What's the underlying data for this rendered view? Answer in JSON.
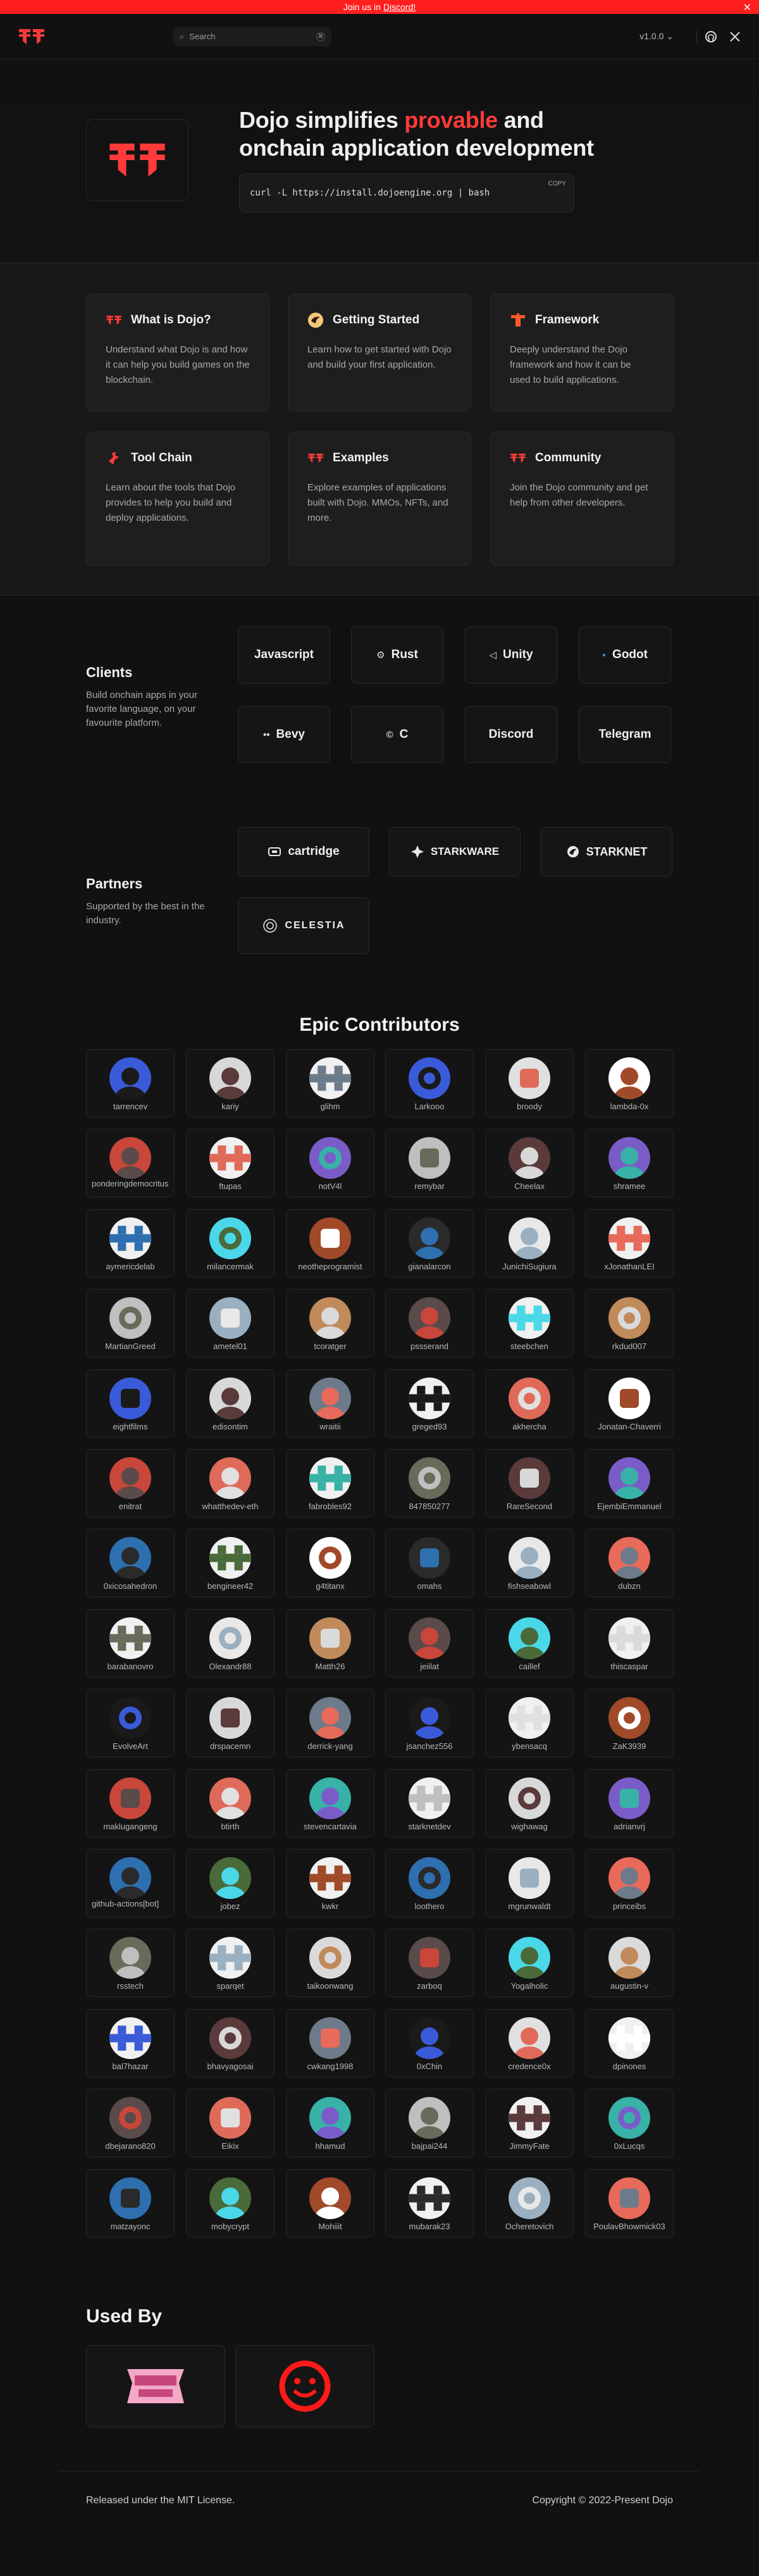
{
  "banner": {
    "text": "Join us in",
    "link": "Discord!",
    "close": "✕"
  },
  "nav": {
    "search_placeholder": "Search",
    "search_shortcut": "⌘",
    "version": "v1.0.0 ⌄",
    "github_icon": "github-icon",
    "x_icon": "x-icon"
  },
  "hero": {
    "title_pre": "Dojo simplifies ",
    "title_highlight": "provable",
    "title_post": " and",
    "title_line2": "onchain application development",
    "command": "curl -L https://install.dojoengine.org | bash",
    "copy_label": "COPY",
    "highlight_color": "#ff3a3a"
  },
  "features": [
    {
      "title": "What is Dojo?",
      "desc": "Understand what Dojo is and how it can help you build games on the blockchain.",
      "icon": "dojo-logo-icon"
    },
    {
      "title": "Getting Started",
      "desc": "Learn how to get started with Dojo and build your first application.",
      "icon": "starknet-bird-icon"
    },
    {
      "title": "Framework",
      "desc": "Deeply understand the Dojo framework and how it can be used to build applications.",
      "icon": "framework-icon"
    },
    {
      "title": "Tool Chain",
      "desc": "Learn about the tools that Dojo provides to help you build and deploy applications.",
      "icon": "toolchain-icon"
    },
    {
      "title": "Examples",
      "desc": "Explore examples of applications built with Dojo. MMOs, NFTs, and more.",
      "icon": "dojo-logo-icon"
    },
    {
      "title": "Community",
      "desc": "Join the Dojo community and get help from other developers.",
      "icon": "dojo-logo-icon"
    }
  ],
  "clients": {
    "title": "Clients",
    "desc": "Build onchain apps in your favorite language, on your favourite platform.",
    "items": [
      {
        "label": "Javascript",
        "icon": ""
      },
      {
        "label": "Rust",
        "icon": "rust-icon"
      },
      {
        "label": "Unity",
        "icon": "unity-icon"
      },
      {
        "label": "Godot",
        "icon": "godot-icon"
      },
      {
        "label": "Bevy",
        "icon": "bevy-icon"
      },
      {
        "label": "C",
        "icon": "c-icon"
      },
      {
        "label": "Discord",
        "icon": ""
      },
      {
        "label": "Telegram",
        "icon": ""
      }
    ]
  },
  "partners": {
    "title": "Partners",
    "desc": "Supported by the best in the industry.",
    "items": [
      {
        "label": "cartridge",
        "icon": "cartridge-icon"
      },
      {
        "label": "STARKWARE",
        "icon": "starkware-icon"
      },
      {
        "label": "STARKNET",
        "icon": "starknet-icon"
      },
      {
        "label": "CELESTIA",
        "icon": "celestia-icon"
      }
    ]
  },
  "contributors": {
    "title": "Epic Contributors",
    "names": [
      "tarrencev",
      "kariy",
      "glihm",
      "Larkooo",
      "broody",
      "lambda-0x",
      "ponderingdemocritus",
      "ftupas",
      "notV4l",
      "remybar",
      "Cheelax",
      "shramee",
      "aymericdelab",
      "milancermak",
      "neotheprogramist",
      "gianalarcon",
      "JunichiSugiura",
      "xJonathanLEI",
      "MartianGreed",
      "ametel01",
      "tcoratger",
      "pssserand",
      "steebchen",
      "rkdud007",
      "eightfilms",
      "edisontim",
      "wraitii",
      "greged93",
      "akhercha",
      "Jonatan-Chaverri",
      "enitrat",
      "whatthedev-eth",
      "fabrobles92",
      "847850277",
      "RareSecond",
      "EjembiEmmanuel",
      "0xicosahedron",
      "bengineer42",
      "g4titanx",
      "omahs",
      "fishseabowl",
      "dubzn",
      "barabanovro",
      "Olexandr88",
      "Matth26",
      "jeiilat",
      "caillef",
      "thiscaspar",
      "EvolveArt",
      "drspacemn",
      "derrick-yang",
      "jsanchez556",
      "ybensacq",
      "ZaK3939",
      "maklugangeng",
      "btirth",
      "stevencartavia",
      "starknetdev",
      "wighawag",
      "adrianvrj",
      "github-actions[bot]",
      "jobez",
      "kwkr",
      "loothero",
      "mgrunwaldt",
      "princeibs",
      "rsstech",
      "sparqet",
      "taikoonwang",
      "zarboq",
      "Yogalholic",
      "augustin-v",
      "bal7hazar",
      "bhavyagosai",
      "cwkang1998",
      "0xChin",
      "credence0x",
      "dpinones",
      "dbejarano820",
      "Eikix",
      "hhamud",
      "bajpai244",
      "JimmyFate",
      "0xLucqs",
      "matzayonc",
      "mobycrypt",
      "Mohiiit",
      "mubarak23",
      "Ocheretovich",
      "PoulavBhowmick03"
    ]
  },
  "used_by": {
    "title": "Used By",
    "items": [
      "realms-logo",
      "smiley-logo"
    ]
  },
  "footer": {
    "left": "Released under the MIT License.",
    "right": "Copyright © 2022-Present Dojo"
  }
}
